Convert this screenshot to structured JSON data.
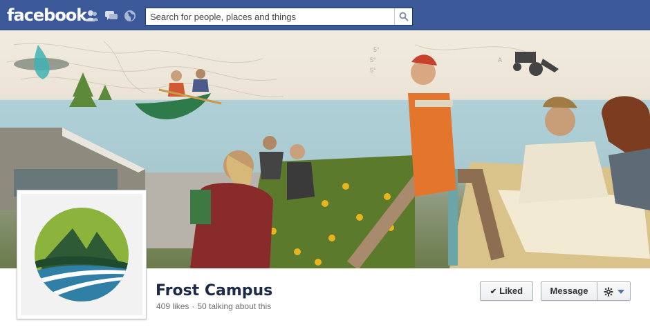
{
  "topbar": {
    "logo": "facebook",
    "search_placeholder": "Search for people, places and things",
    "icons": [
      "friend-requests-icon",
      "messages-icon",
      "notifications-globe-icon",
      "search-icon"
    ]
  },
  "cover": {
    "description_icons": [
      "cover-photo"
    ]
  },
  "page": {
    "name": "Frost Campus",
    "likes": "409 likes",
    "separator": "·",
    "talking": "50 talking about this"
  },
  "actions": {
    "liked_label": "Liked",
    "liked_check": "✔",
    "message_label": "Message",
    "gear_icon": "gear-icon",
    "caret_icon": "caret-down-icon"
  },
  "colors": {
    "brand_blue": "#3b5998",
    "name_color": "#1c2a47",
    "logo_green": "#8cb43c",
    "logo_blue": "#2f7fa6"
  }
}
